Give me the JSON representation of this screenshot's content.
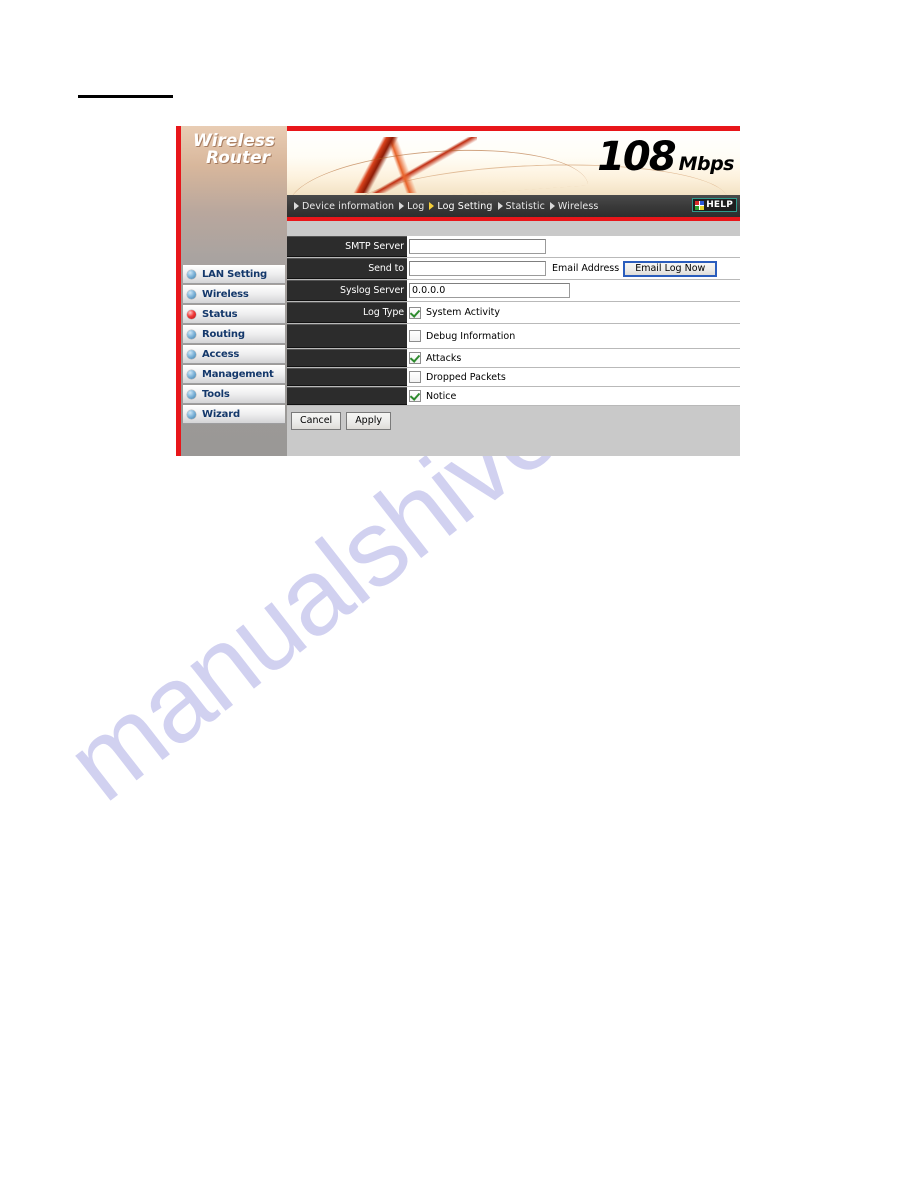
{
  "page": {
    "watermark": "manualshive.com"
  },
  "router_ui": {
    "brand": {
      "line1": "Wireless",
      "line2": "Router"
    },
    "banner": {
      "speed_number": "108",
      "speed_unit": "Mbps"
    },
    "nav": {
      "items": [
        {
          "label": "Device information",
          "active": false
        },
        {
          "label": "Log",
          "active": false
        },
        {
          "label": "Log Setting",
          "active": true
        },
        {
          "label": "Statistic",
          "active": false
        },
        {
          "label": "Wireless",
          "active": false
        }
      ],
      "help_label": "HELP"
    },
    "sidebar": {
      "items": [
        {
          "label": "LAN Setting",
          "active": false
        },
        {
          "label": "Wireless",
          "active": false
        },
        {
          "label": "Status",
          "active": true
        },
        {
          "label": "Routing",
          "active": false
        },
        {
          "label": "Access",
          "active": false
        },
        {
          "label": "Management",
          "active": false
        },
        {
          "label": "Tools",
          "active": false
        },
        {
          "label": "Wizard",
          "active": false
        }
      ]
    },
    "form": {
      "smtp_server": {
        "label": "SMTP Server",
        "value": "",
        "placeholder": ""
      },
      "send_to": {
        "label": "Send to",
        "value": "",
        "placeholder": "",
        "suffix_label": "Email Address",
        "button_label": "Email Log Now"
      },
      "syslog_server": {
        "label": "Syslog Server",
        "value": "0.0.0.0",
        "placeholder": ""
      },
      "log_type": {
        "label": "Log Type",
        "options": [
          {
            "label": "System Activity",
            "checked": true
          },
          {
            "label": "Debug Information",
            "checked": false
          },
          {
            "label": "Attacks",
            "checked": true
          },
          {
            "label": "Dropped Packets",
            "checked": false
          },
          {
            "label": "Notice",
            "checked": true
          }
        ]
      },
      "actions": {
        "cancel_label": "Cancel",
        "apply_label": "Apply"
      }
    },
    "colors": {
      "accent_red": "#e8161a",
      "label_bg": "#2c2c2c",
      "panel_bg": "#c9c9c9",
      "menu_text": "#14386b",
      "check_green": "#2e8b2e",
      "focus_blue": "#2a5dbd",
      "watermark": "#c9c9ee"
    }
  }
}
